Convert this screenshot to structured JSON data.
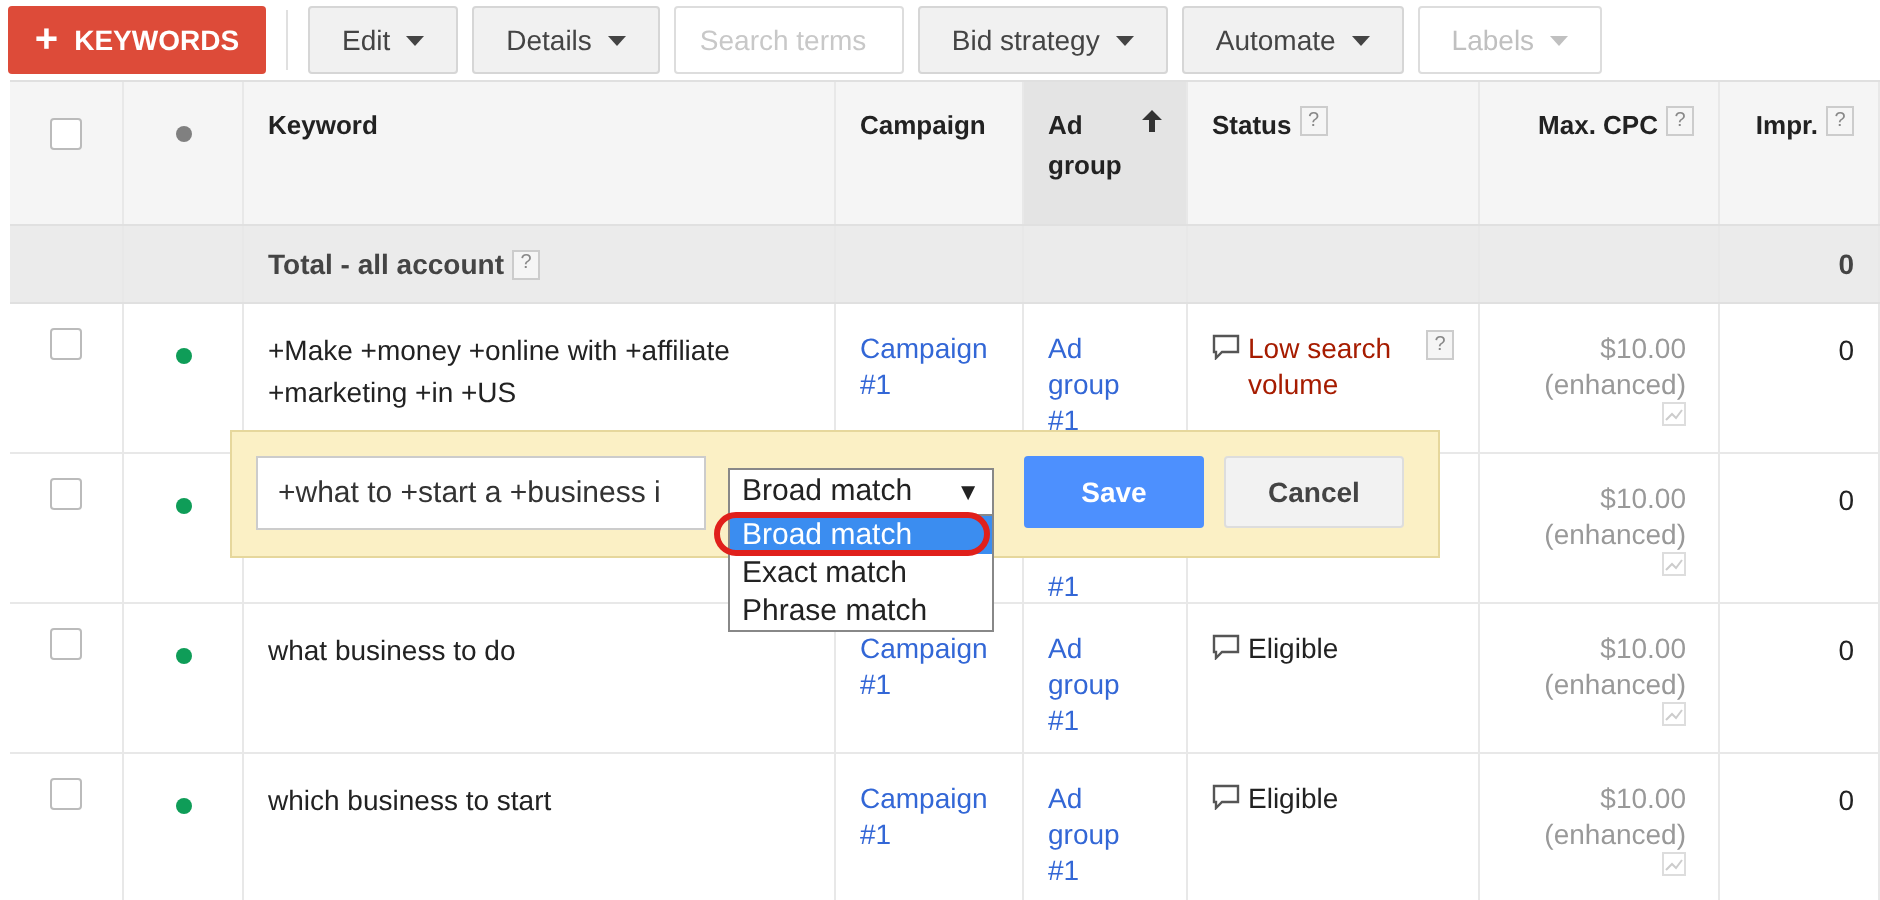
{
  "toolbar": {
    "add_button": {
      "icon": "+",
      "label": "KEYWORDS"
    },
    "items": [
      {
        "kind": "menu",
        "label": "Edit",
        "disabled": false
      },
      {
        "kind": "menu",
        "label": "Details",
        "disabled": false
      },
      {
        "kind": "field",
        "placeholder": "Search terms",
        "disabled": true
      },
      {
        "kind": "menu",
        "label": "Bid strategy",
        "disabled": false
      },
      {
        "kind": "menu",
        "label": "Automate",
        "disabled": false
      },
      {
        "kind": "menu",
        "label": "Labels",
        "disabled": true
      }
    ]
  },
  "table": {
    "header": {
      "checked": false,
      "color": "#808080"
    },
    "columns": [
      {
        "label": "Keyword",
        "sorted": false
      },
      {
        "label": "Campaign",
        "sorted": false
      },
      {
        "label": "Ad group",
        "sorted": true
      },
      {
        "label": "Status",
        "help": "?",
        "sorted": false
      },
      {
        "label": "Max. CPC",
        "help": "?",
        "sorted": false
      },
      {
        "label": "Impr.",
        "help": "?",
        "sorted": false
      }
    ],
    "total": {
      "label": "Total - all account",
      "help": "?",
      "impr": "0"
    },
    "rows": [
      {
        "checked": false,
        "color": "#0f9d58",
        "keyword": "+Make +money +online with +affiliate +marketing +in +US",
        "campaign": "Campaign #1",
        "ad_group": "Ad group #1",
        "status": {
          "kind": "warning",
          "text": "Low search volume",
          "help": "?"
        },
        "max_cpc": "$10.00",
        "bid_note": "(enhanced)",
        "impr": "0"
      },
      {
        "checked": false,
        "color": "#0f9d58",
        "ad_group": "#1",
        "max_cpc": "$10.00",
        "bid_note": "(enhanced)",
        "impr": "0"
      },
      {
        "checked": false,
        "color": "#0f9d58",
        "keyword": "what business to do",
        "campaign": "Campaign #1",
        "ad_group": "Ad group #1",
        "status": {
          "kind": "eligible",
          "text": "Eligible"
        },
        "max_cpc": "$10.00",
        "bid_note": "(enhanced)",
        "impr": "0"
      },
      {
        "checked": false,
        "color": "#0f9d58",
        "keyword": "which business to start",
        "campaign": "Campaign #1",
        "ad_group": "Ad group #1",
        "status": {
          "kind": "eligible",
          "text": "Eligible"
        },
        "max_cpc": "$10.00",
        "bid_note": "(enhanced)",
        "impr": "0"
      }
    ]
  },
  "editor": {
    "value": "+what to +start a +business i",
    "match_type": "Broad match",
    "arrow": "▼",
    "options": [
      {
        "label": "Broad match",
        "selected": true
      },
      {
        "label": "Exact match",
        "selected": false
      },
      {
        "label": "Phrase match",
        "selected": false
      }
    ],
    "save": "Save",
    "cancel": "Cancel"
  }
}
